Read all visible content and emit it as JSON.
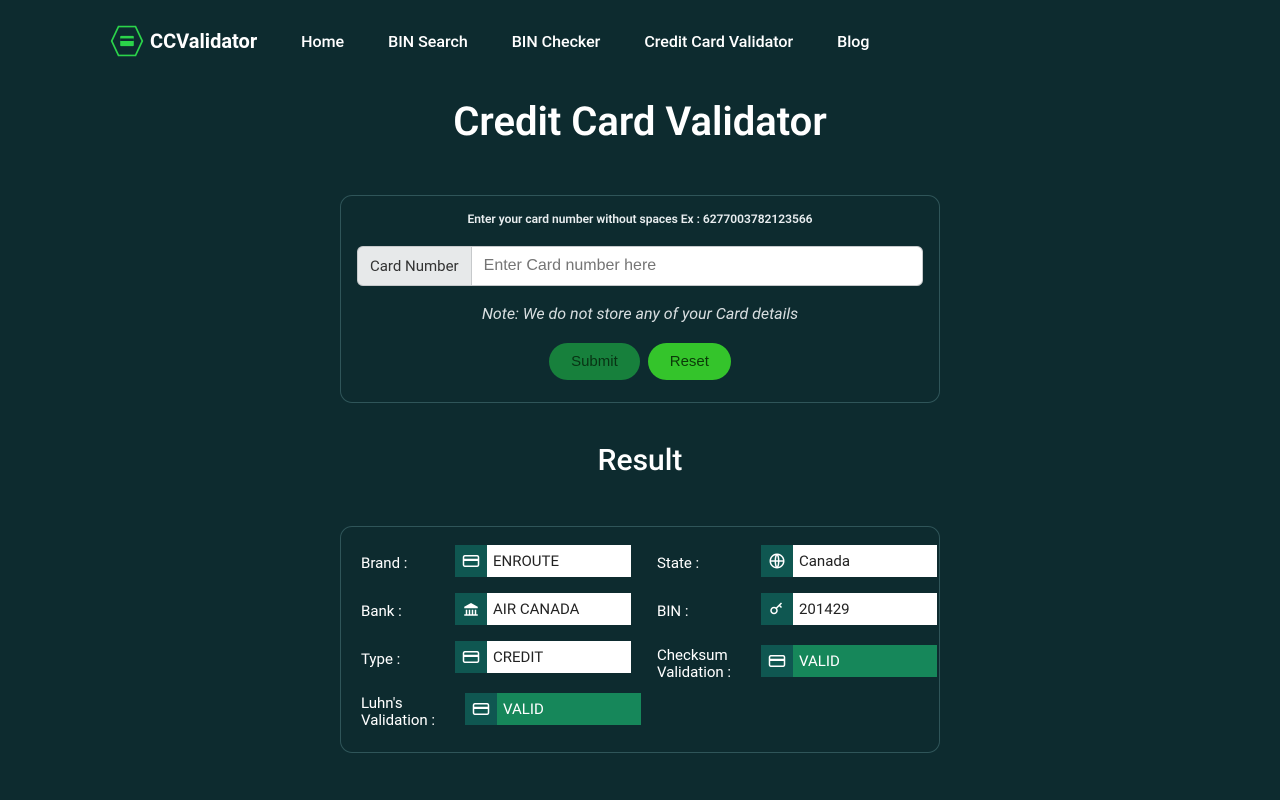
{
  "brand": {
    "name": "CCValidator"
  },
  "nav": {
    "home": "Home",
    "bin_search": "BIN Search",
    "bin_checker": "BIN Checker",
    "cc_validator": "Credit Card Validator",
    "blog": "Blog"
  },
  "page": {
    "title": "Credit Card Validator",
    "result_heading": "Result"
  },
  "form": {
    "instruction": "Enter your card number without spaces Ex : 6277003782123566",
    "prefix": "Card Number",
    "placeholder": "Enter Card number here",
    "note": "Note: We do not store any of your Card details",
    "submit_label": "Submit",
    "reset_label": "Reset"
  },
  "result": {
    "labels": {
      "brand": "Brand :",
      "bank": "Bank :",
      "type": "Type :",
      "luhns": "Luhn's Validation :",
      "state": "State :",
      "bin": "BIN :",
      "checksum": "Checksum Validation :"
    },
    "values": {
      "brand": "ENROUTE",
      "bank": "AIR CANADA",
      "type": "CREDIT",
      "luhns": "VALID",
      "state": "Canada",
      "bin": "201429",
      "checksum": "VALID"
    }
  },
  "colors": {
    "bg": "#0d2b2f",
    "panel_border": "#2f5559",
    "icon_bg": "#0f5751",
    "valid_bg": "#16875a",
    "brand_green": "#17803c",
    "brand_lime": "#34c42b"
  }
}
